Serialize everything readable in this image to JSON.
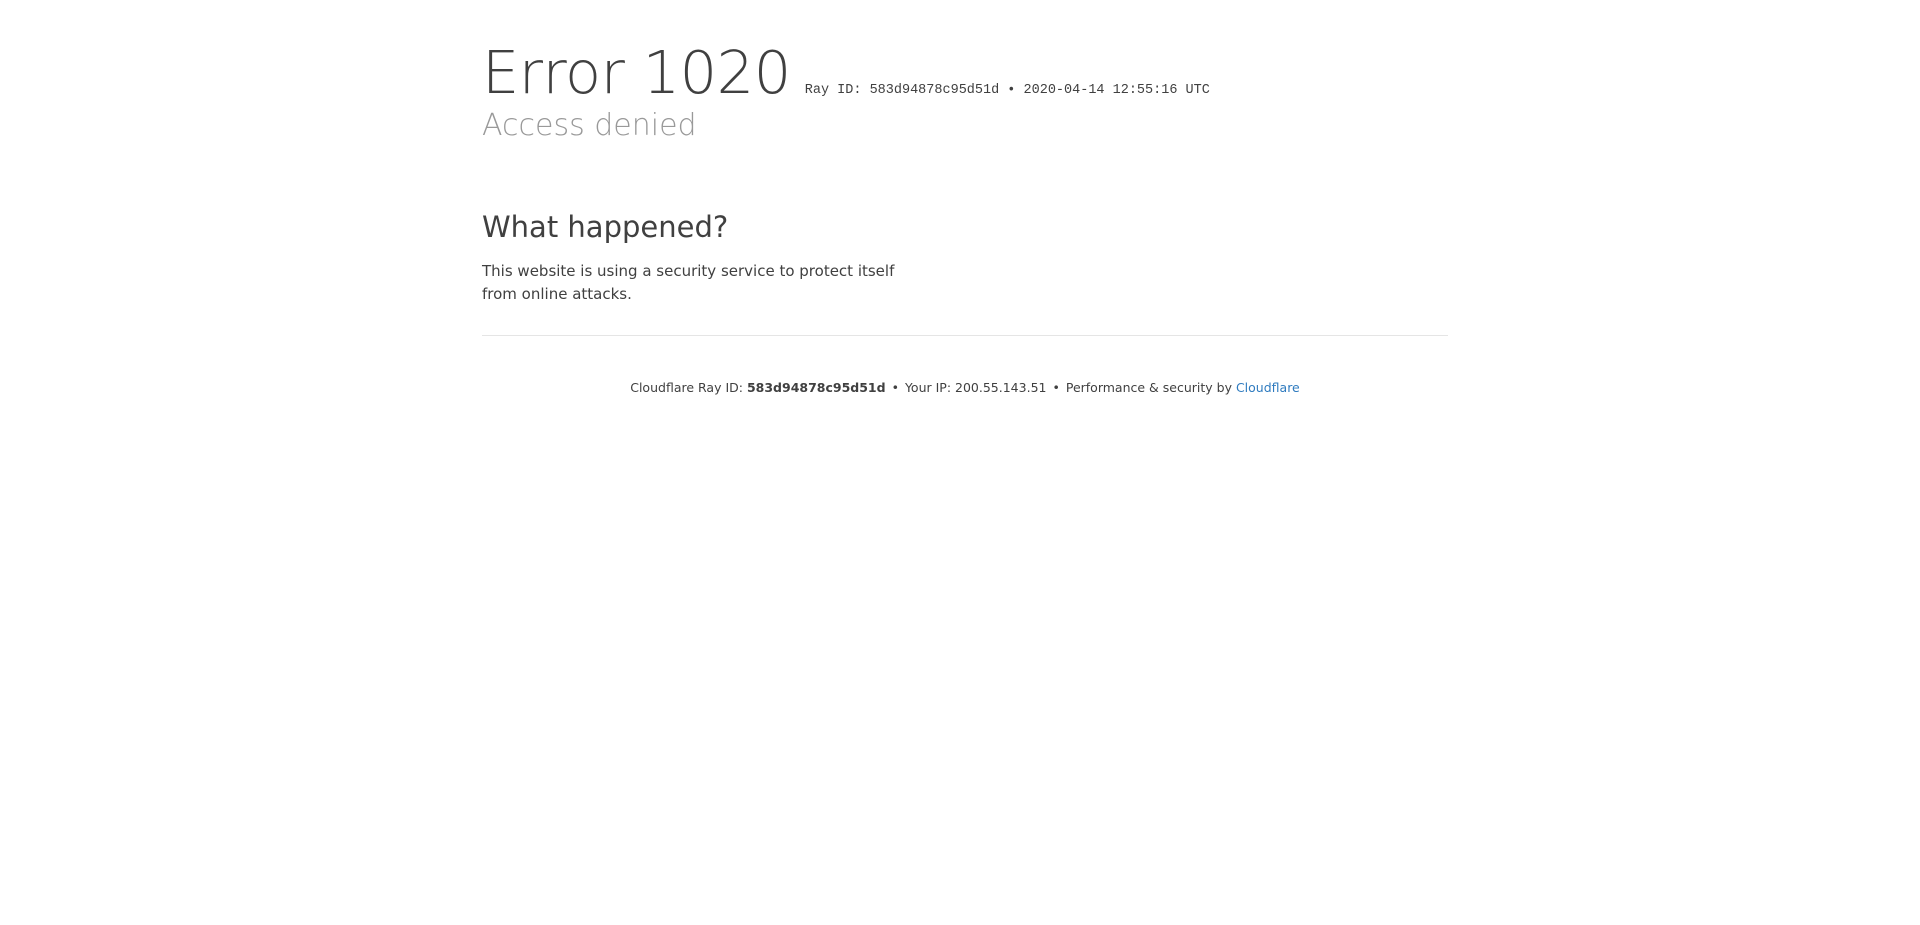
{
  "header": {
    "title": "Error 1020",
    "ray_label": "Ray ID: 583d94878c95d51d",
    "meta_separator": " • ",
    "timestamp": "2020-04-14 12:55:16 UTC",
    "subtitle": "Access denied"
  },
  "main": {
    "heading": "What happened?",
    "text": "This website is using a security service to protect itself from online attacks."
  },
  "footer": {
    "ray_prefix": "Cloudflare Ray ID: ",
    "ray_id": "583d94878c95d51d",
    "separator": "•",
    "ip_text": "Your IP: 200.55.143.51",
    "perf_text": "Performance & security by ",
    "link_label": "Cloudflare"
  },
  "colors": {
    "text": "#404040",
    "muted": "#999999",
    "link": "#2f7bbf",
    "divider": "#e5e5e5"
  }
}
